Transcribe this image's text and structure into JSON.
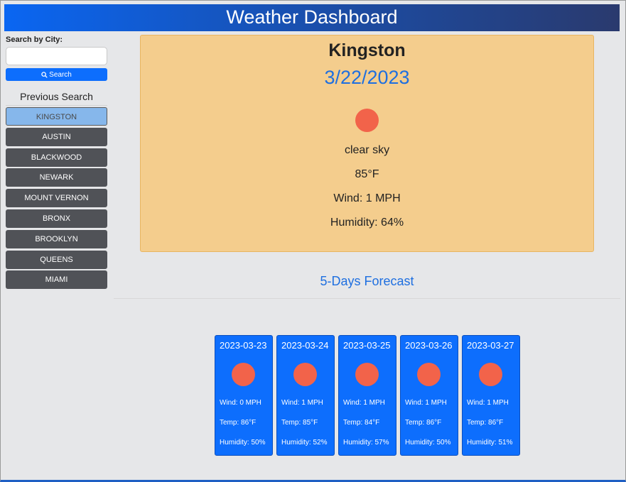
{
  "header": {
    "title": "Weather Dashboard"
  },
  "sidebar": {
    "search_label": "Search by City:",
    "search_value": "",
    "search_button": "Search",
    "previous_title": "Previous Search",
    "cities": [
      "KINGSTON",
      "AUSTIN",
      "BLACKWOOD",
      "NEWARK",
      "MOUNT VERNON",
      "BRONX",
      "BROOKLYN",
      "QUEENS",
      "MIAMI"
    ],
    "active_city": "KINGSTON"
  },
  "current": {
    "city": "Kingston",
    "date": "3/22/2023",
    "icon": "sun-icon",
    "description": "clear sky",
    "temp": "85°F",
    "wind": "Wind: 1 MPH",
    "humidity": "Humidity: 64%"
  },
  "forecast": {
    "title": "5-Days Forecast",
    "days": [
      {
        "date": "2023-03-23",
        "wind": "Wind: 0 MPH",
        "temp": "Temp: 86°F",
        "humidity": "Humidity: 50%"
      },
      {
        "date": "2023-03-24",
        "wind": "Wind: 1 MPH",
        "temp": "Temp: 85°F",
        "humidity": "Humidity: 52%"
      },
      {
        "date": "2023-03-25",
        "wind": "Wind: 1 MPH",
        "temp": "Temp: 84°F",
        "humidity": "Humidity: 57%"
      },
      {
        "date": "2023-03-26",
        "wind": "Wind: 1 MPH",
        "temp": "Temp: 86°F",
        "humidity": "Humidity: 50%"
      },
      {
        "date": "2023-03-27",
        "wind": "Wind: 1 MPH",
        "temp": "Temp: 86°F",
        "humidity": "Humidity: 51%"
      }
    ]
  },
  "colors": {
    "accent": "#0d6efd",
    "sun": "#f2634a",
    "current_panel": "#f4cd8d",
    "city_button": "#505257",
    "active_city_button": "#86b7eb"
  }
}
